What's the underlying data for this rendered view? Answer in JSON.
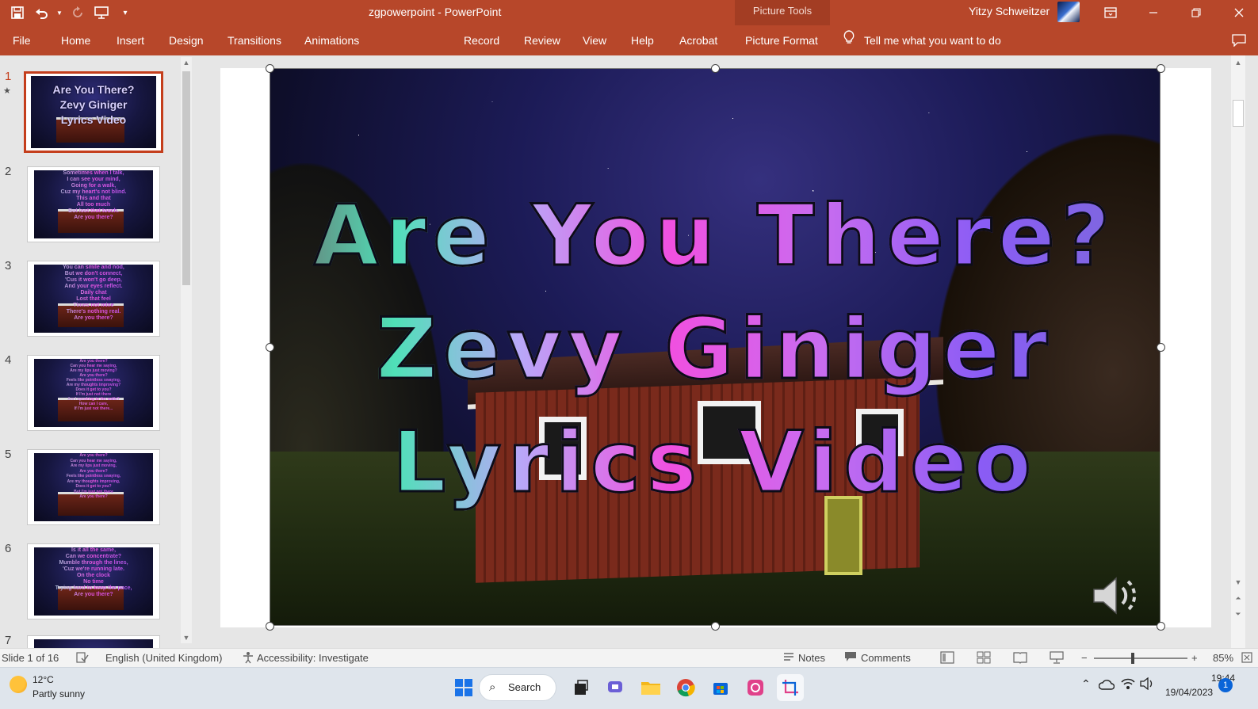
{
  "app": {
    "doc_name": "zgpowerpoint",
    "separator": " - ",
    "app_name": "PowerPoint",
    "picture_tools": "Picture Tools",
    "user": "Yitzy Schweitzer",
    "accent": "#b7472a"
  },
  "ribbon": {
    "tabs": [
      "File",
      "Home",
      "Insert",
      "Design",
      "Transitions",
      "Animations",
      "Record",
      "Review",
      "View",
      "Help",
      "Acrobat",
      "Picture Format"
    ],
    "tell_me": "Tell me what you want to do"
  },
  "thumbnails": [
    {
      "num": "1",
      "text": "Are You There?\nZevy Giniger\nLyrics Video",
      "selected": true,
      "star": "★"
    },
    {
      "num": "2",
      "text": "Sometimes when I talk,\nI can see your mind,\nGoing for a walk,\nCuz my heart's not blind.\nThis and that\nAll too much\nBut lost that touch.\nAre you there?"
    },
    {
      "num": "3",
      "text": "You can smile and nod,\nBut we don't connect,\n'Cus it won't go deep,\nAnd your eyes reflect.\nDaily chat\nLost that feel\nTimes not mine\nThere's nothing real.\nAre you there?"
    },
    {
      "num": "4",
      "text": "Are you there?\nCan you hear me saying,\nAre my lips just moving?\nAre you there?\nFeels like pointless swaying,\nAre my thoughts improving?\nDoes it get to you?\nIf I'm just not there\nAm I speaking to the walls?\nHow can I care,\nIf I'm just not there..."
    },
    {
      "num": "5",
      "text": "Are you there?\nCan you hear me saying,\nAre my lips just moving,\nAre you there?\nFeels like pointless swaying,\nAre my thoughts improving,\nDoes it get to you?\nBut I'm just not there\nAre you there?"
    },
    {
      "num": "6",
      "text": "Is it all the same,\nCan we concentrate?\nMumble through the lines,\n'Cuz we're running late.\nOn the clock\nNo time\nTrying hard to keep the pace,\nAre you there?"
    },
    {
      "num": "7",
      "text": ""
    }
  ],
  "slide": {
    "title_lines": [
      "Are You There?",
      "Zevy Giniger",
      "Lyrics Video"
    ]
  },
  "status": {
    "slide_of": "Slide 1 of 16",
    "language": "English (United Kingdom)",
    "accessibility": "Accessibility: Investigate",
    "notes": "Notes",
    "comments": "Comments",
    "zoom": "85%"
  },
  "taskbar": {
    "temp": "12°C",
    "weather": "Partly sunny",
    "search": "Search",
    "time": "19:44",
    "date": "19/04/2023",
    "notifications": "1"
  }
}
